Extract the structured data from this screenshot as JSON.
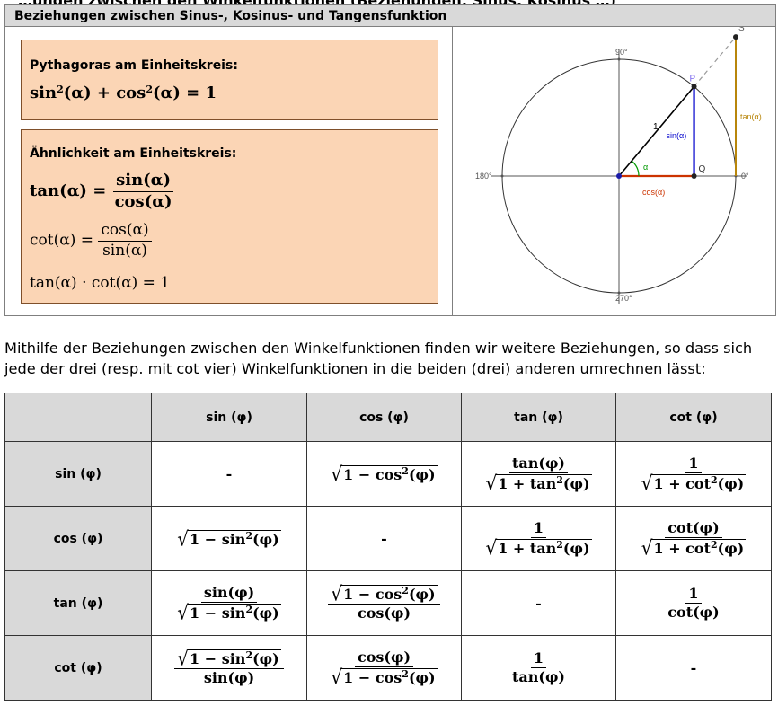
{
  "top_cutoff": "…ungen zwischen den Winkelfunktionen (Beziehungen: Sinus, Kosinus …)",
  "header": "Beziehungen zwischen Sinus-, Kosinus- und Tangensfunktion",
  "box1": {
    "title": "Pythagoras am Einheitskreis:",
    "formula": "sin²(α) + cos²(α) = 1"
  },
  "box2": {
    "title": "Ähnlichkeit am Einheitskreis:",
    "tan_lhs": "tan(α) =",
    "tan_num": "sin(α)",
    "tan_den": "cos(α)",
    "cot_lhs": "cot(α) =",
    "cot_num": "cos(α)",
    "cot_den": "sin(α)",
    "product": "tan(α) · cot(α) = 1"
  },
  "diagram": {
    "label_90": "90°",
    "label_180": "180°",
    "label_270": "270°",
    "label_0": "0°",
    "P": "P",
    "Q": "Q",
    "S": "S",
    "one": "1",
    "alpha": "α",
    "sin": "sin(α)",
    "cos": "cos(α)",
    "tan": "tan(α)",
    "angle_deg": 50,
    "colors": {
      "sin": "#0000cc",
      "cos": "#cc3300",
      "tan": "#b8860b",
      "alpha": "#009900",
      "P": "#7b68ee"
    }
  },
  "paragraph": "Mithilfe der Beziehungen zwischen den Winkelfunktionen finden wir weitere Beziehungen, so dass sich jede der drei (resp. mit cot vier) Winkelfunktionen in die beiden (drei) anderen umrechnen lässt:",
  "table": {
    "columns": [
      "sin (φ)",
      "cos (φ)",
      "tan (φ)",
      "cot (φ)"
    ],
    "rows": [
      "sin (φ)",
      "cos (φ)",
      "tan (φ)",
      "cot (φ)"
    ],
    "dash": "-",
    "one": "1",
    "one_minus_cos2": "1 − cos",
    "one_minus_sin2": "1 − sin",
    "one_plus_tan2": "1 + tan",
    "one_plus_cot2": "1 + cot",
    "sq": "2",
    "phi": "(φ)",
    "tan_phi": "tan(φ)",
    "cot_phi": "cot(φ)",
    "sin_phi": "sin(φ)",
    "cos_phi": "cos(φ)"
  }
}
